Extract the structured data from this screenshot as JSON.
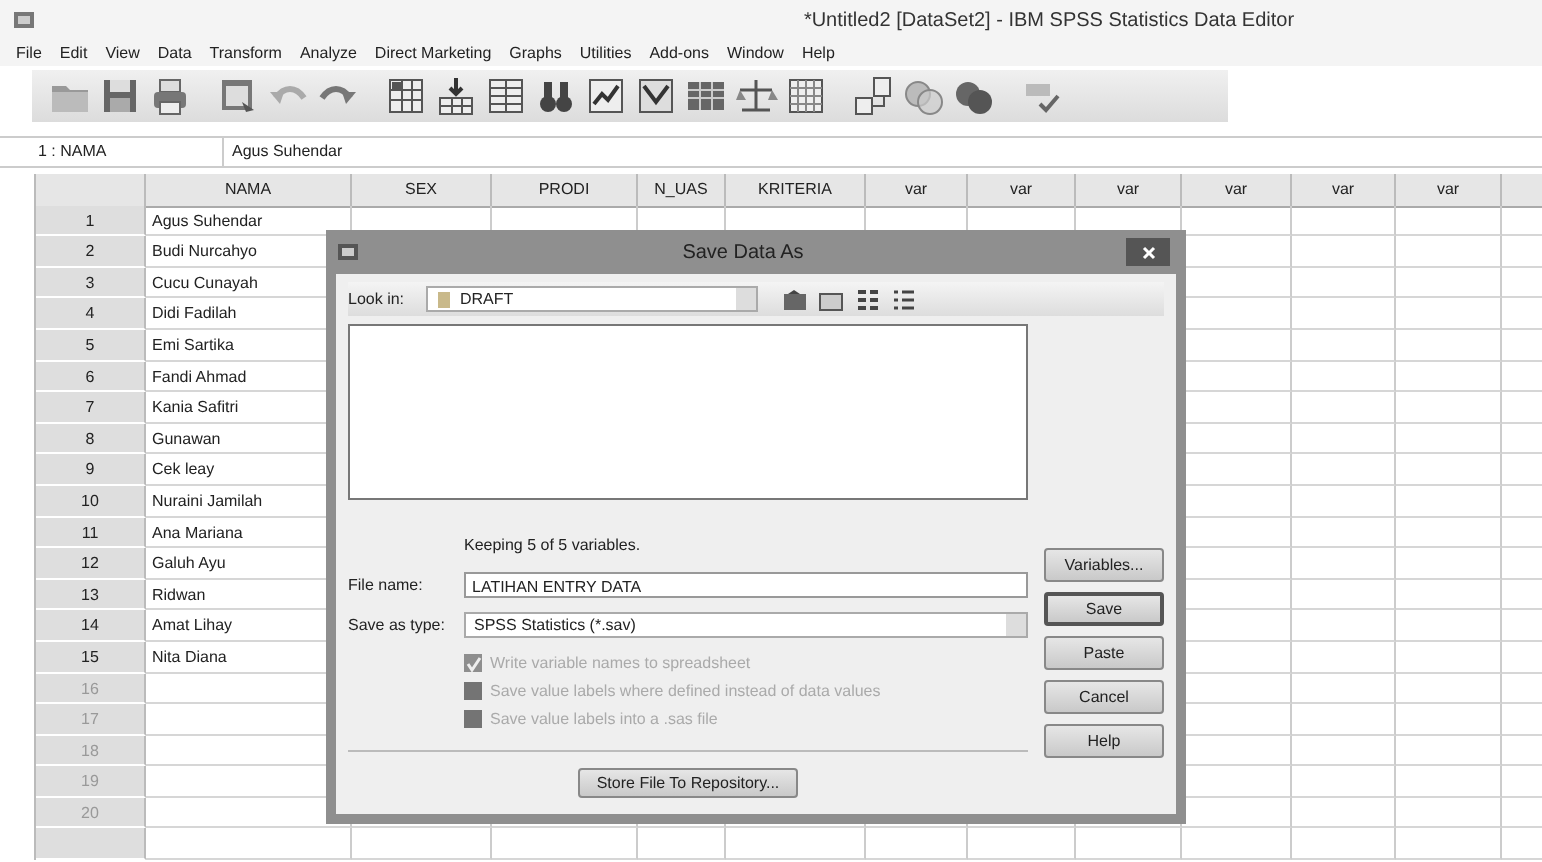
{
  "window": {
    "title": "*Untitled2 [DataSet2] - IBM SPSS Statistics Data Editor"
  },
  "menu": [
    "File",
    "Edit",
    "View",
    "Data",
    "Transform",
    "Analyze",
    "Direct Marketing",
    "Graphs",
    "Utilities",
    "Add-ons",
    "Window",
    "Help"
  ],
  "cell_editor": {
    "reference": "1 : NAMA",
    "value": "Agus Suhendar"
  },
  "table": {
    "columns": [
      "NAMA",
      "SEX",
      "PRODI",
      "N_UAS",
      "KRITERIA",
      "var",
      "var",
      "var",
      "var",
      "var",
      "var"
    ],
    "rows": [
      {
        "number": "1",
        "cells": [
          "Agus Suhendar"
        ]
      },
      {
        "number": "2",
        "cells": [
          "Budi Nurcahyo"
        ]
      },
      {
        "number": "3",
        "cells": [
          "Cucu Cunayah"
        ]
      },
      {
        "number": "4",
        "cells": [
          "Didi Fadilah"
        ]
      },
      {
        "number": "5",
        "cells": [
          "Emi Sartika"
        ]
      },
      {
        "number": "6",
        "cells": [
          "Fandi Ahmad"
        ]
      },
      {
        "number": "7",
        "cells": [
          "Kania Safitri"
        ]
      },
      {
        "number": "8",
        "cells": [
          "Gunawan"
        ]
      },
      {
        "number": "9",
        "cells": [
          "Cek leay"
        ]
      },
      {
        "number": "10",
        "cells": [
          "Nuraini Jamilah"
        ]
      },
      {
        "number": "11",
        "cells": [
          "Ana Mariana"
        ]
      },
      {
        "number": "12",
        "cells": [
          "Galuh Ayu"
        ]
      },
      {
        "number": "13",
        "cells": [
          "Ridwan"
        ]
      },
      {
        "number": "14",
        "cells": [
          "Amat Lihay"
        ]
      },
      {
        "number": "15",
        "cells": [
          "Nita Diana"
        ]
      },
      {
        "number": "16",
        "cells": []
      },
      {
        "number": "17",
        "cells": []
      },
      {
        "number": "18",
        "cells": []
      },
      {
        "number": "19",
        "cells": []
      },
      {
        "number": "20",
        "cells": []
      }
    ]
  },
  "dialog": {
    "title": "Save Data As",
    "look_in_label": "Look in:",
    "look_in_value": "DRAFT",
    "keeping": "Keeping 5 of 5 variables.",
    "file_name_label": "File name:",
    "file_name_value": "LATIHAN ENTRY DATA",
    "save_as_type_label": "Save as type:",
    "save_as_type_value": "SPSS Statistics (*.sav)",
    "checkboxes": [
      {
        "label": "Write variable names to spreadsheet",
        "checked": true,
        "disabled": true
      },
      {
        "label": "Save value labels where defined instead of data values",
        "checked": false,
        "disabled": true
      },
      {
        "label": "Save value labels into a .sas file",
        "checked": false,
        "disabled": true
      }
    ],
    "buttons": [
      {
        "label": "Variables...",
        "default": false
      },
      {
        "label": "Save",
        "default": true
      },
      {
        "label": "Paste",
        "default": false
      },
      {
        "label": "Cancel",
        "default": false
      },
      {
        "label": "Help",
        "default": false
      }
    ],
    "store_button": "Store File To Repository..."
  }
}
